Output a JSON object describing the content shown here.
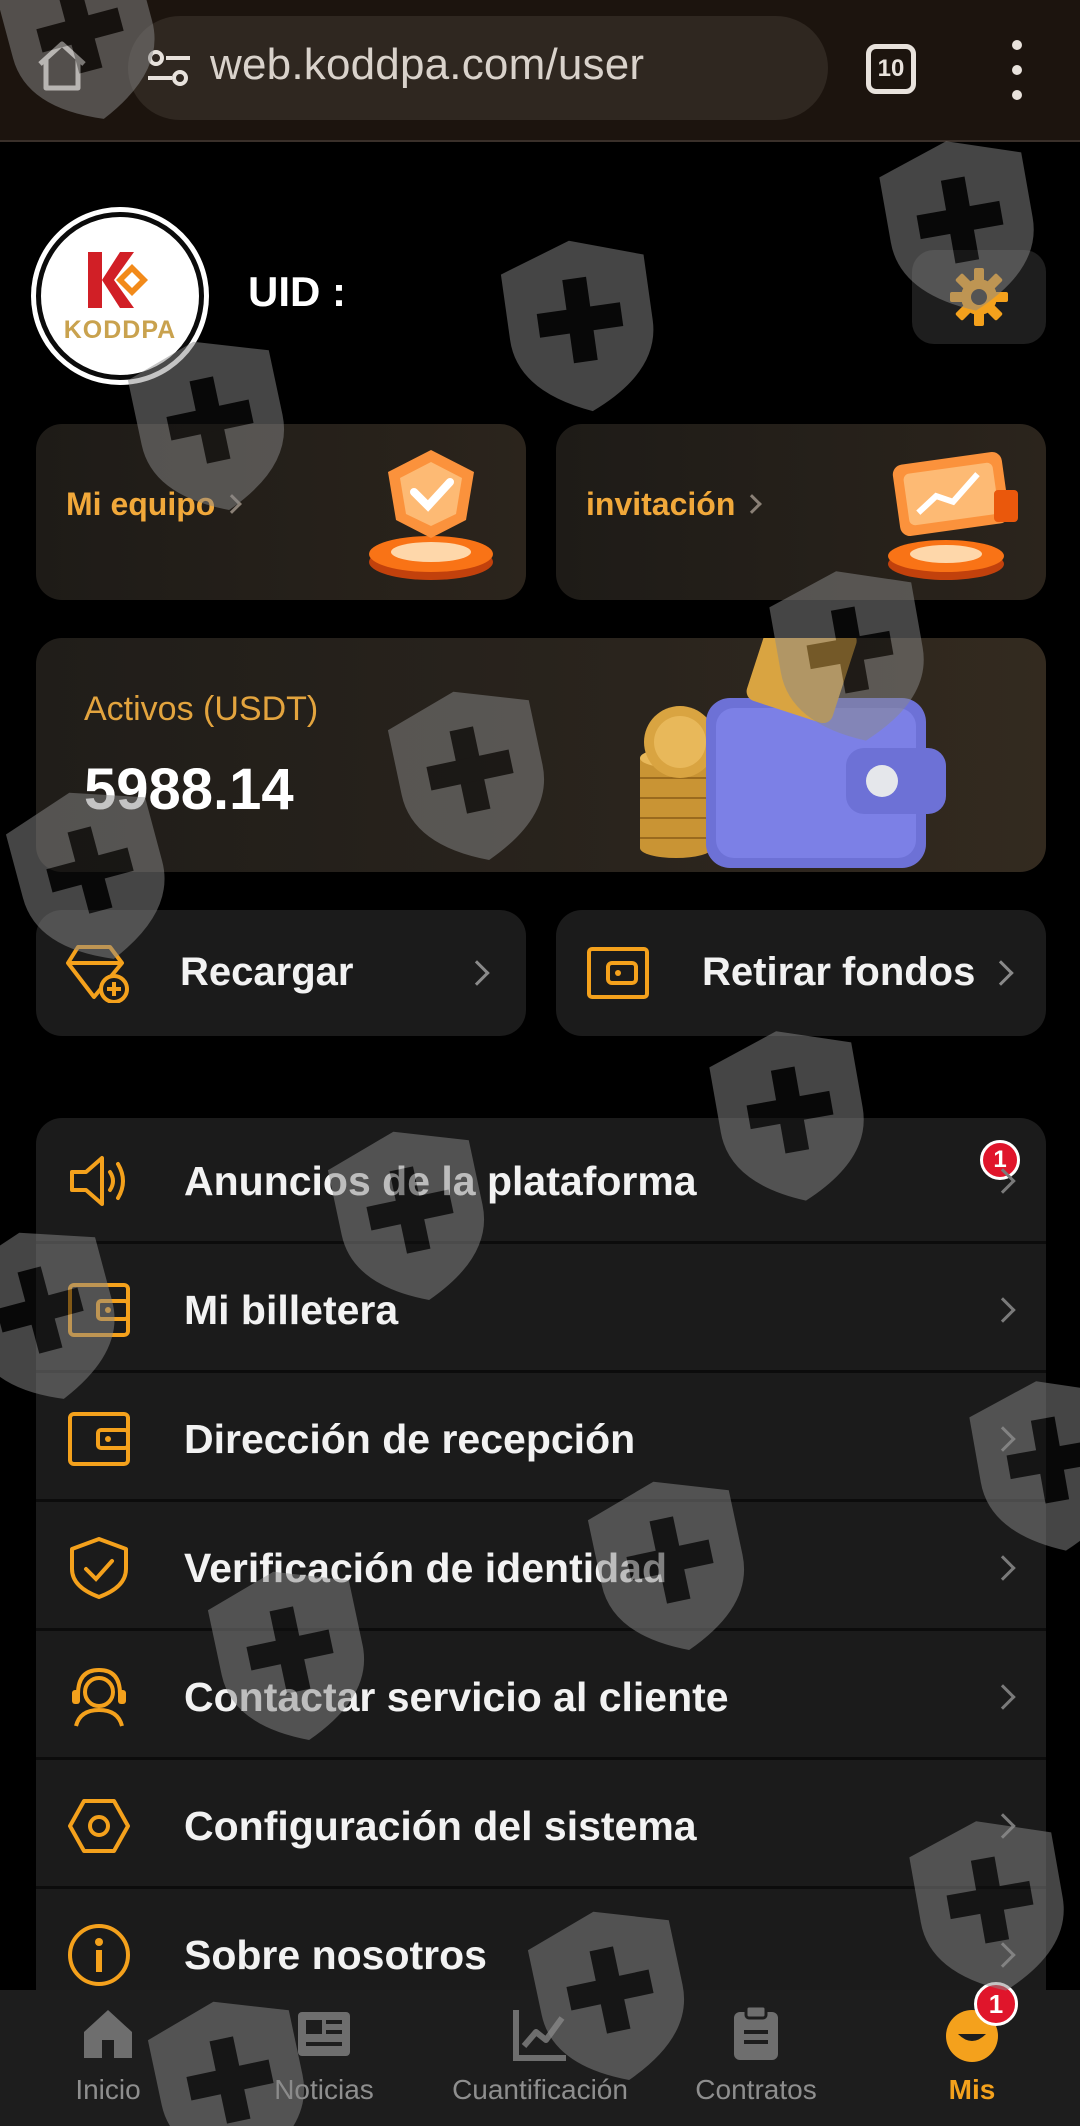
{
  "browser": {
    "url": "web.koddpa.com/user",
    "tab_count": "10"
  },
  "profile": {
    "logo_text": "KODDPA",
    "uid_label": "UID :"
  },
  "promos": {
    "team_label": "Mi equipo",
    "invite_label": "invitación"
  },
  "assets": {
    "label": "Activos (USDT)",
    "value": "5988.14"
  },
  "actions": {
    "recharge_label": "Recargar",
    "withdraw_label": "Retirar fondos"
  },
  "menu": {
    "items": [
      {
        "label": "Anuncios de la plataforma",
        "icon": "speaker-icon",
        "badge": "1"
      },
      {
        "label": "Mi billetera",
        "icon": "wallet-icon"
      },
      {
        "label": "Dirección de recepción",
        "icon": "receive-wallet-icon"
      },
      {
        "label": "Verificación de identidad",
        "icon": "shield-check-icon"
      },
      {
        "label": "Contactar servicio al cliente",
        "icon": "headset-icon"
      },
      {
        "label": "Configuración del sistema",
        "icon": "hexagon-settings-icon"
      },
      {
        "label": "Sobre nosotros",
        "icon": "info-icon"
      }
    ]
  },
  "bottom_nav": {
    "items": [
      {
        "label": "Inicio",
        "icon": "home-icon"
      },
      {
        "label": "Noticias",
        "icon": "news-icon"
      },
      {
        "label": "Cuantificación",
        "icon": "chart-icon"
      },
      {
        "label": "Contratos",
        "icon": "clipboard-icon"
      },
      {
        "label": "Mis",
        "icon": "profile-icon",
        "active": true
      }
    ],
    "badge": "1"
  },
  "colors": {
    "accent": "#f4a11c",
    "background": "#000000",
    "card": "#1b1b1b",
    "badge": "#e0152b"
  }
}
